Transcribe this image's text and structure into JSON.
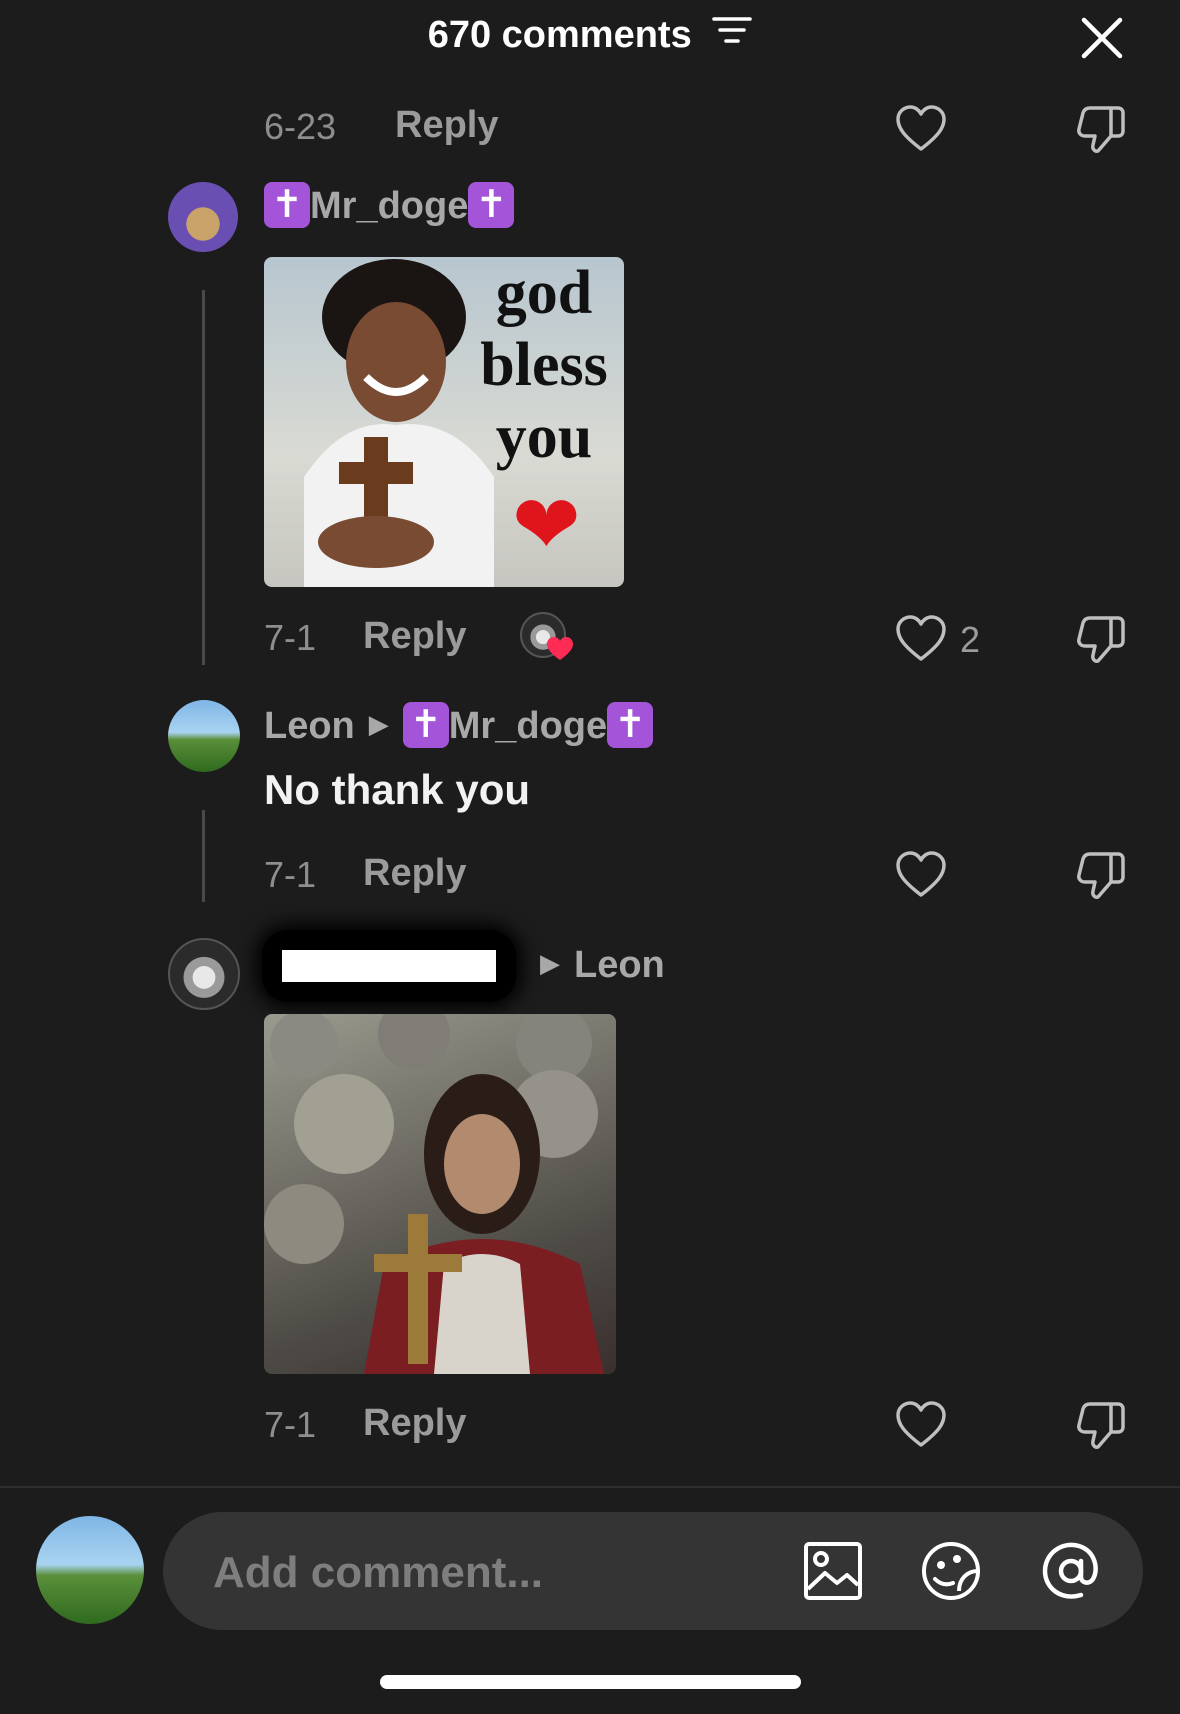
{
  "header": {
    "comment_count_label": "670 comments",
    "filter_icon": "filter-sort-icon",
    "close_icon": "close-icon"
  },
  "comments": [
    {
      "id": "prev-footer",
      "date": "6-23",
      "reply_label": "Reply"
    },
    {
      "id": "mr-doge",
      "username_cross_left": "✝",
      "username": "Mr_doge",
      "username_cross_right": "✝",
      "image": {
        "caption_line1": "god",
        "caption_line2": "bless",
        "caption_line3": "you",
        "heart": "❤"
      },
      "date": "7-1",
      "reply_label": "Reply",
      "like_count": "2"
    },
    {
      "id": "leon",
      "username": "Leon",
      "reply_to_cross_left": "✝",
      "reply_to": "Mr_doge",
      "reply_to_cross_right": "✝",
      "text": "No thank you",
      "date": "7-1",
      "reply_label": "Reply"
    },
    {
      "id": "redacted-user",
      "reply_to": "Leon",
      "date": "7-1",
      "reply_label": "Reply"
    }
  ],
  "composer": {
    "placeholder": "Add comment...",
    "icons": [
      "image-icon",
      "sticker-icon",
      "mention-icon"
    ]
  },
  "colors": {
    "background": "#1c1c1c",
    "muted_text": "#8e8e8e",
    "cross_badge": "#a454d8",
    "heart_red": "#e0141b"
  }
}
